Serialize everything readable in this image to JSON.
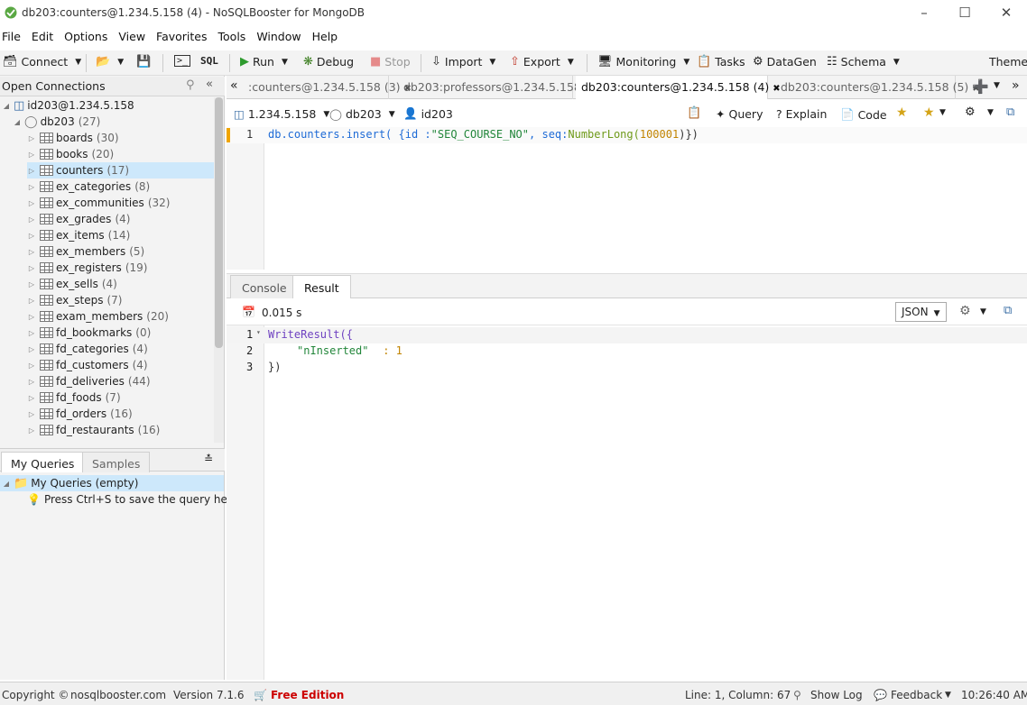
{
  "window": {
    "title": "db203:counters@1.234.5.158 (4) - NoSQLBooster for MongoDB"
  },
  "menu": [
    "File",
    "Edit",
    "Options",
    "View",
    "Favorites",
    "Tools",
    "Window",
    "Help"
  ],
  "toolbar": {
    "connect": "Connect",
    "sql": "SQL",
    "run": "Run",
    "debug": "Debug",
    "stop": "Stop",
    "import": "Import",
    "export": "Export",
    "monitoring": "Monitoring",
    "tasks": "Tasks",
    "datagen": "DataGen",
    "schema": "Schema",
    "theme": "Theme"
  },
  "left": {
    "header": "Open Connections",
    "connection": "id203@1.234.5.158",
    "db": {
      "name": "db203",
      "count": "(27)"
    },
    "collections": [
      {
        "name": "boards",
        "count": "(30)"
      },
      {
        "name": "books",
        "count": "(20)"
      },
      {
        "name": "counters",
        "count": "(17)"
      },
      {
        "name": "ex_categories",
        "count": "(8)"
      },
      {
        "name": "ex_communities",
        "count": "(32)"
      },
      {
        "name": "ex_grades",
        "count": "(4)"
      },
      {
        "name": "ex_items",
        "count": "(14)"
      },
      {
        "name": "ex_members",
        "count": "(5)"
      },
      {
        "name": "ex_registers",
        "count": "(19)"
      },
      {
        "name": "ex_sells",
        "count": "(4)"
      },
      {
        "name": "ex_steps",
        "count": "(7)"
      },
      {
        "name": "exam_members",
        "count": "(20)"
      },
      {
        "name": "fd_bookmarks",
        "count": "(0)"
      },
      {
        "name": "fd_categories",
        "count": "(4)"
      },
      {
        "name": "fd_customers",
        "count": "(4)"
      },
      {
        "name": "fd_deliveries",
        "count": "(44)"
      },
      {
        "name": "fd_foods",
        "count": "(7)"
      },
      {
        "name": "fd_orders",
        "count": "(16)"
      },
      {
        "name": "fd_restaurants",
        "count": "(16)"
      }
    ],
    "tabs": {
      "my_queries": "My Queries",
      "samples": "Samples"
    },
    "queries_root": "My Queries (empty)",
    "queries_hint": "Press Ctrl+S to save the query here"
  },
  "doc_tabs": [
    {
      "label": ":counters@1.234.5.158 (3)"
    },
    {
      "label": "db203:professors@1.234.5.158"
    },
    {
      "label": "db203:counters@1.234.5.158 (4)"
    },
    {
      "label": "db203:counters@1.234.5.158 (5)"
    }
  ],
  "conbar": {
    "host": "1.234.5.158",
    "db": "db203",
    "user": "id203",
    "query": "Query",
    "explain": "Explain",
    "code": "Code"
  },
  "editor": {
    "line_no": "1",
    "code": {
      "p1": "db.counters.insert(",
      "p2": " {id :",
      "p3": "\"SEQ_COURSE_NO\"",
      "p4": ", seq:",
      "p5": "NumberLong(",
      "p6": "100001",
      "p7": ")})"
    }
  },
  "result_tabs": {
    "console": "Console",
    "result": "Result"
  },
  "result": {
    "time": "0.015 s",
    "format": "JSON",
    "lines": [
      {
        "no": "1",
        "text_a": "WriteResult({",
        "text_b": ""
      },
      {
        "no": "2",
        "text_a": "\"nInserted\"",
        "text_b": " : 1"
      },
      {
        "no": "3",
        "text_a": "})",
        "text_b": ""
      }
    ]
  },
  "status": {
    "copyright": "Copyright ©",
    "site": "nosqlbooster.com",
    "version": "Version 7.1.6",
    "edition": "Free Edition",
    "position": "Line: 1, Column: 67",
    "show_log": "Show Log",
    "feedback": "Feedback",
    "time": "10:26:40 AM"
  },
  "colors": {
    "accent": "#1e6bd6",
    "keyword": "#6f42c1",
    "string": "#22863a",
    "number": "#c18401",
    "red": "#cc0000"
  }
}
